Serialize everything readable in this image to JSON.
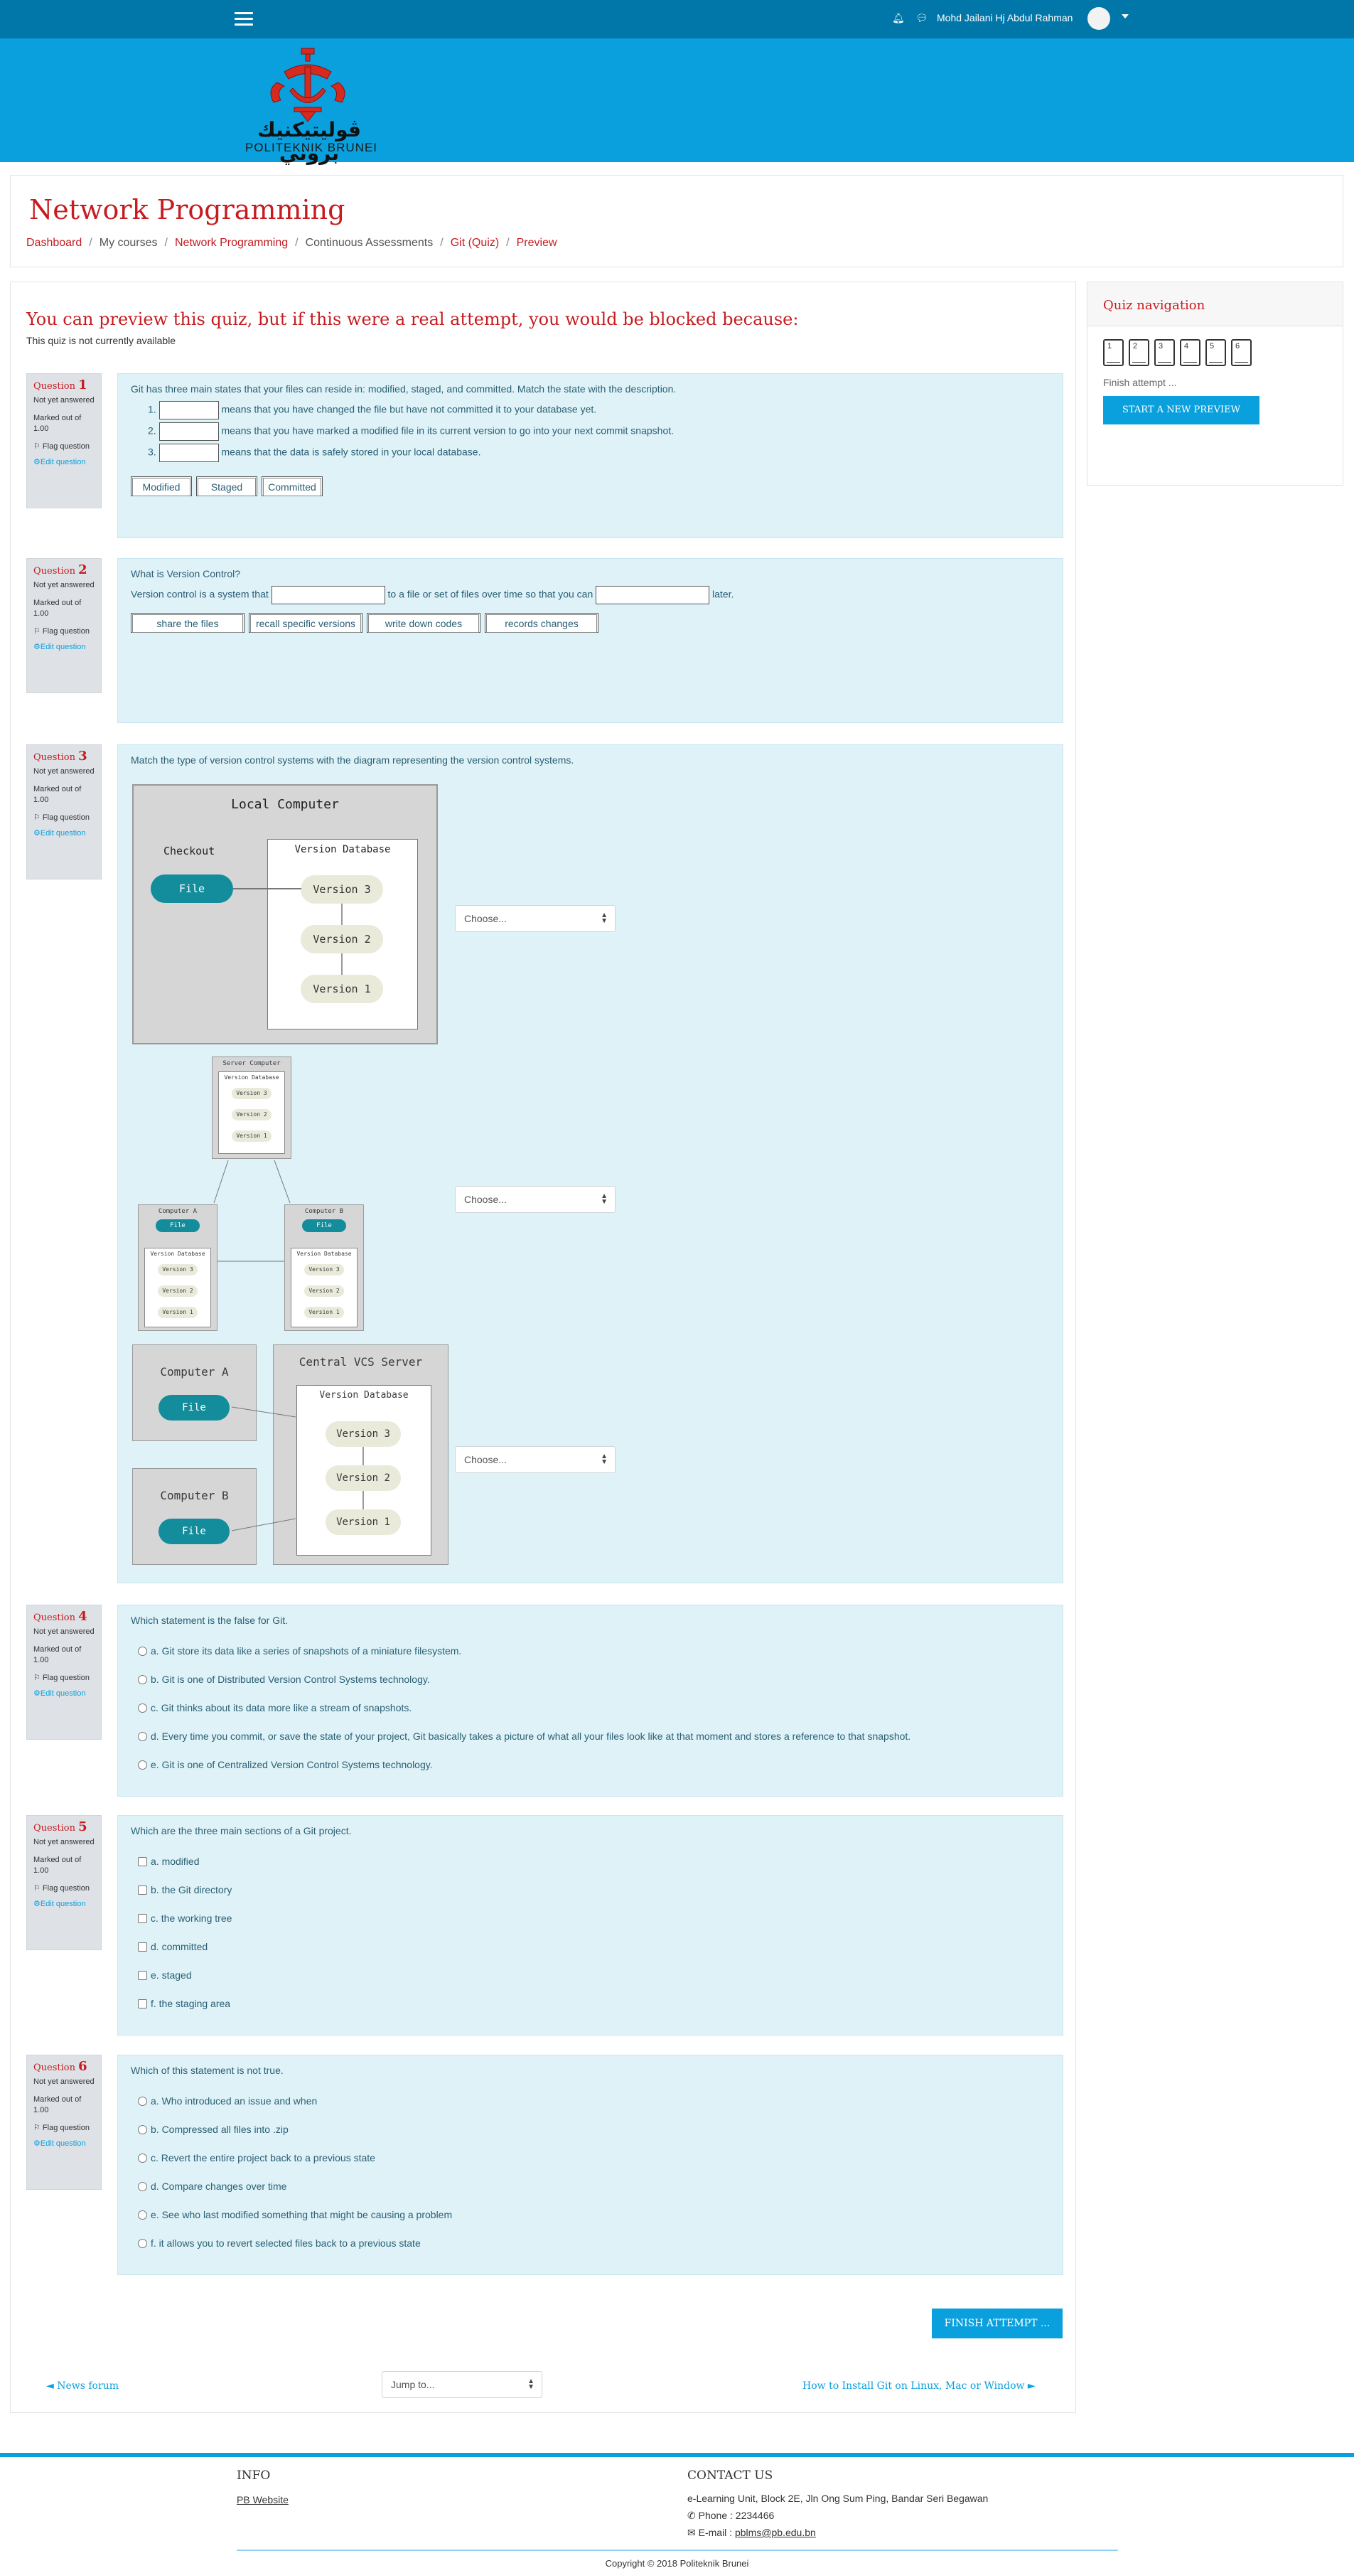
{
  "navbar": {
    "user_name": "Mohd Jailani Hj Abdul Rahman",
    "bell_icon": "bell-icon",
    "chat_icon": "chat-icon"
  },
  "logo": {
    "arabic": "ڤوليتيكنيك بروني",
    "latin": "POLITEKNIK BRUNEI"
  },
  "page": {
    "title": "Network Programming",
    "breadcrumb": [
      "Dashboard",
      "My courses",
      "Network Programming",
      "Continuous Assessments",
      "Git (Quiz)",
      "Preview"
    ]
  },
  "preview": {
    "heading": "You can preview this quiz, but if this were a real attempt, you would be blocked because:",
    "note": "This quiz is not currently available"
  },
  "question_info": {
    "label": "Question",
    "status": "Not yet answered",
    "marked": "Marked out of 1.00",
    "flag": "Flag question",
    "edit": "Edit question"
  },
  "questions": {
    "q1": {
      "number": "1",
      "text": "Git has three main states that your files can reside in: modified, staged, and committed. Match the state with the description.",
      "items": [
        {
          "num": "1.",
          "text": "means that you have changed the file but have not committed it to your database yet."
        },
        {
          "num": "2.",
          "text": "means that you have marked a modified file in its current version to go into your next commit snapshot."
        },
        {
          "num": "3.",
          "text": "means that the data is safely stored in your local database."
        }
      ],
      "choices": [
        "Modified",
        "Staged",
        "Committed"
      ]
    },
    "q2": {
      "number": "2",
      "text": "What is Version Control?",
      "sentence_a": "Version control is a system that",
      "sentence_b": "to a file or set of files over time so that you can",
      "sentence_c": "later.",
      "choices": [
        "share the files",
        "recall specific versions",
        "write down codes",
        "records changes"
      ]
    },
    "q3": {
      "number": "3",
      "text": "Match the type of version control systems with the diagram representing the version control systems.",
      "select_placeholder": "Choose...",
      "diagram1": {
        "title": "Local Computer",
        "checkout": "Checkout",
        "db": "Version Database",
        "file": "File",
        "versions": [
          "Version 3",
          "Version 2",
          "Version 1"
        ]
      },
      "diagram2": {
        "server": "Server Computer",
        "db": "Version Database",
        "comp_a": "Computer A",
        "comp_b": "Computer B",
        "file": "File",
        "versions": [
          "Version 3",
          "Version 2",
          "Version 1"
        ]
      },
      "diagram3": {
        "comp_a": "Computer A",
        "comp_b": "Computer B",
        "server": "Central VCS Server",
        "db": "Version Database",
        "file": "File",
        "versions": [
          "Version 3",
          "Version 2",
          "Version 1"
        ]
      }
    },
    "q4": {
      "number": "4",
      "text": "Which statement is the false for Git.",
      "options": [
        "a. Git store its data like a series of snapshots of a miniature filesystem.",
        "b. Git is one of Distributed Version Control Systems technology.",
        "c. Git thinks about its data more like a stream of snapshots.",
        "d. Every time you commit, or save the state of your project, Git basically takes a picture of what all your files look like at that moment and stores a reference to that snapshot.",
        "e. Git is one of Centralized Version Control Systems technology."
      ]
    },
    "q5": {
      "number": "5",
      "text": "Which are the three main sections of a Git project.",
      "options": [
        "a. modified",
        "b. the Git directory",
        "c. the working tree",
        "d. committed",
        "e. staged",
        "f. the staging area"
      ]
    },
    "q6": {
      "number": "6",
      "text": "Which of this statement is not true.",
      "options": [
        "a. Who introduced an issue and when",
        "b. Compressed all files into .zip",
        "c. Revert the entire project back to a previous state",
        "d. Compare changes over time",
        "e. See who last modified something that might be causing a problem",
        "f. it allows you to revert selected files back to a previous state"
      ]
    }
  },
  "actions": {
    "finish_attempt": "FINISH ATTEMPT ...",
    "prev_activity": "◄ News forum",
    "jump_to": "Jump to...",
    "next_activity": "How to Install Git on Linux, Mac or Window ►"
  },
  "quiz_nav": {
    "title": "Quiz navigation",
    "buttons": [
      "1",
      "2",
      "3",
      "4",
      "5",
      "6"
    ],
    "finish": "Finish attempt ...",
    "new_preview": "START A NEW PREVIEW"
  },
  "footer": {
    "info_title": "INFO",
    "info_link": "PB Website",
    "contact_title": "CONTACT US",
    "address": "e-Learning Unit, Block 2E, Jln Ong Sum Ping, Bandar Seri Begawan",
    "phone": "Phone : 2234466",
    "email_label": "E-mail : ",
    "email": "pblms@pb.edu.bn",
    "copyright": "Copyright © 2018 Politeknik Brunei"
  },
  "colors": {
    "navbar": "#0176a8",
    "banner": "#0aa0dd",
    "accent_red": "#c61c20",
    "question_bg": "#def2f8"
  }
}
